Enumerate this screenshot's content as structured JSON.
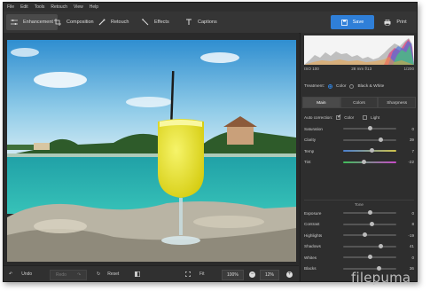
{
  "menu": [
    "File",
    "Edit",
    "Tools",
    "Retouch",
    "View",
    "Help"
  ],
  "tabs": [
    {
      "label": "Enhancement",
      "icon": "sliders-icon"
    },
    {
      "label": "Composition",
      "icon": "crop-icon"
    },
    {
      "label": "Retouch",
      "icon": "brush-icon"
    },
    {
      "label": "Effects",
      "icon": "magic-wand-icon"
    },
    {
      "label": "Captions",
      "icon": "text-icon"
    }
  ],
  "actions": {
    "save_label": "Save",
    "print_label": "Print"
  },
  "exif": {
    "iso": "ISO 100",
    "focal": "28 mm f/13",
    "shutter": "1/200"
  },
  "treatment": {
    "label": "Treatment:",
    "color": "Color",
    "bw": "Black & White",
    "selected": "Color"
  },
  "panel_tabs": [
    "Main",
    "Colors",
    "Sharpness"
  ],
  "auto_correction": {
    "label": "Auto correction:",
    "color": "Color",
    "light": "Light",
    "color_checked": true,
    "light_checked": false
  },
  "sliders_top": [
    {
      "label": "Saturation",
      "value": "0",
      "level": 0.5
    },
    {
      "label": "Clarity",
      "value": "39",
      "level": 0.7
    },
    {
      "label": "Temp",
      "value": "7",
      "level": 0.54
    },
    {
      "label": "Tint",
      "value": "-22",
      "level": 0.39
    }
  ],
  "tone_label": "Tone",
  "sliders_tone": [
    {
      "label": "Exposure",
      "value": "0",
      "level": 0.5
    },
    {
      "label": "Contrast",
      "value": "8",
      "level": 0.54
    },
    {
      "label": "Highlights",
      "value": "-19",
      "level": 0.4
    },
    {
      "label": "Shadows",
      "value": "41",
      "level": 0.7
    },
    {
      "label": "Whites",
      "value": "0",
      "level": 0.5
    },
    {
      "label": "Blacks",
      "value": "36",
      "level": 0.68
    }
  ],
  "bottom": {
    "undo": "Undo",
    "redo": "Redo",
    "reset": "Reset",
    "fit": "Fit",
    "zoom_actual": "100%",
    "zoom_current": "12%"
  },
  "watermark": "filepuma",
  "colors": {
    "accent": "#2f7fd8",
    "panel": "#2e2e2e",
    "toolbar": "#353535"
  }
}
